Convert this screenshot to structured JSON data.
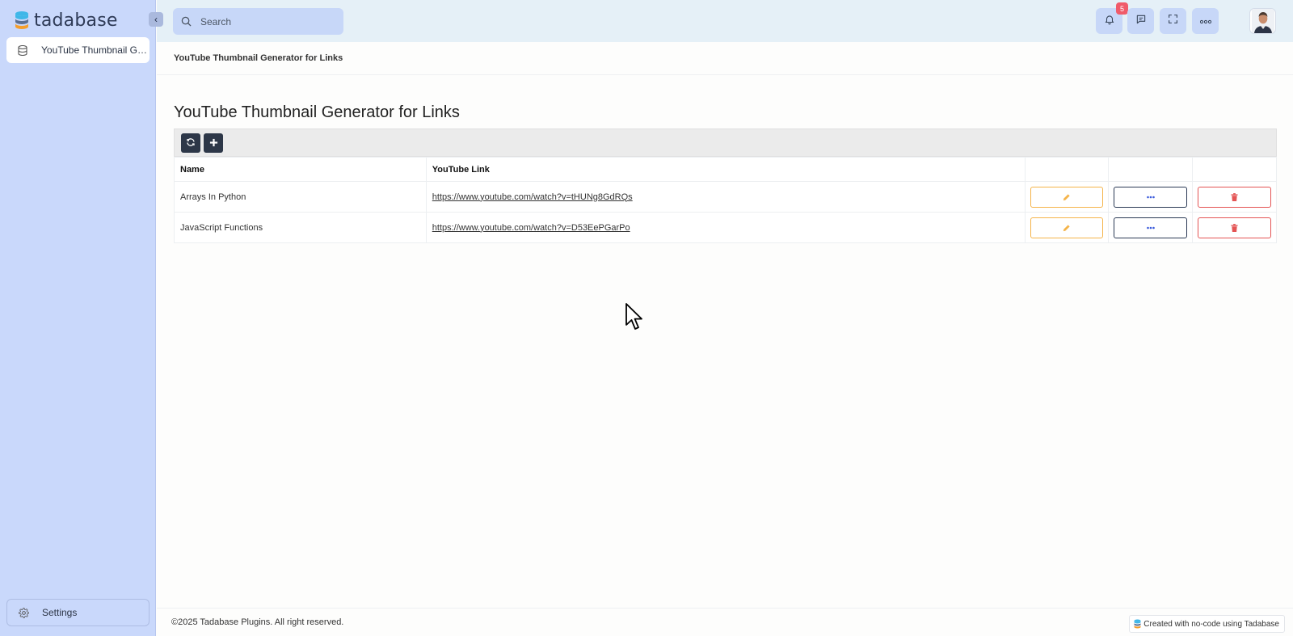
{
  "app": {
    "name": "tadabase",
    "brand_colors": {
      "cyan": "#3fb7e8",
      "orange": "#f59e2b",
      "dark": "#2f3b57"
    }
  },
  "sidebar": {
    "collapse_icon": "chevron-left-icon",
    "items": [
      {
        "label": "YouTube Thumbnail Generator for Links",
        "icon": "database-icon",
        "active": true
      }
    ],
    "settings": {
      "label": "Settings",
      "icon": "gear-icon"
    }
  },
  "topbar": {
    "search": {
      "placeholder": "Search",
      "value": ""
    },
    "notifications": {
      "count": "5",
      "icon": "bell-icon"
    },
    "buttons": [
      "bell-icon",
      "chat-icon",
      "fullscreen-icon",
      "more-horizontal-icon"
    ]
  },
  "breadcrumb": {
    "text": "YouTube Thumbnail Generator for Links"
  },
  "page": {
    "title": "YouTube Thumbnail Generator for Links"
  },
  "table": {
    "toolbar": [
      "refresh-icon",
      "plus-icon"
    ],
    "columns": [
      "Name",
      "YouTube Link",
      "",
      "",
      ""
    ],
    "rows": [
      {
        "name": "Arrays In Python",
        "link": "https://www.youtube.com/watch?v=tHUNg8GdRQs"
      },
      {
        "name": "JavaScript Functions",
        "link": "https://www.youtube.com/watch?v=D53EePGarPo"
      }
    ],
    "row_actions": [
      "edit-icon",
      "more-icon",
      "delete-icon"
    ],
    "action_colors": {
      "edit": "#f5b44a",
      "more": "#2b3a55",
      "delete": "#e45454"
    }
  },
  "footer": {
    "copyright": "©2025 Tadabase Plugins. All right reserved.",
    "made_with": "Created with no-code using Tadabase"
  }
}
